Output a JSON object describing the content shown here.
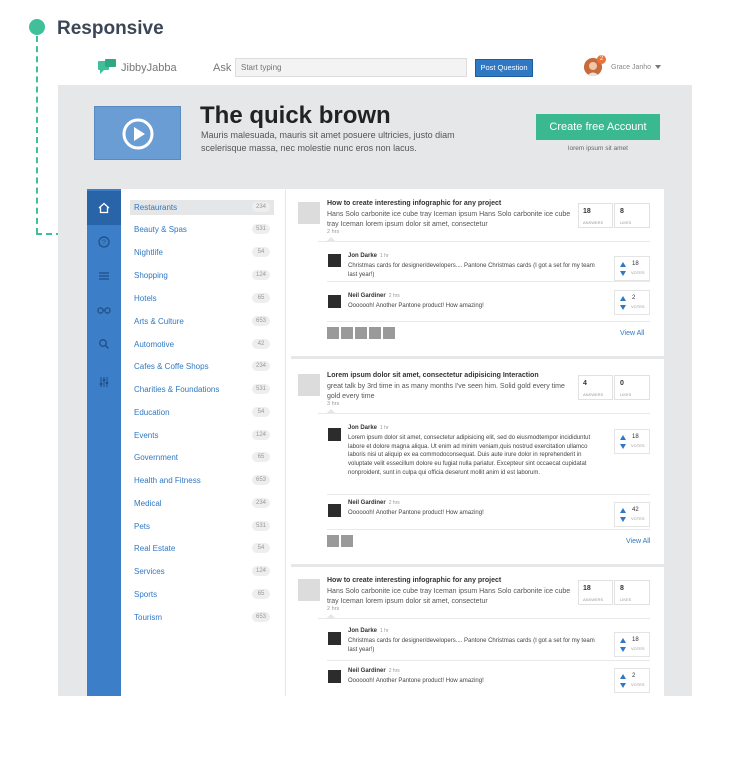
{
  "annotation": {
    "title": "Responsive"
  },
  "header": {
    "logo": "JibbyJabba",
    "ask_label": "Ask",
    "search_placeholder": "Start typing",
    "post_button": "Post Question",
    "user_name": "Grace Janho",
    "notification_count": "2"
  },
  "hero": {
    "title": "The quick brown",
    "description": "Mauris malesuada, mauris sit amet posuere ultricies, justo diam scelerisque massa, nec molestie nunc eros non lacus.",
    "cta": "Create free Account",
    "cta_sub": "lorem ipsum sit amet"
  },
  "nav_icons": [
    "home-icon",
    "question-icon",
    "menu-icon",
    "glasses-icon",
    "search-icon",
    "settings-sliders-icon"
  ],
  "categories": [
    {
      "label": "Restaurants",
      "count": "234"
    },
    {
      "label": "Beauty & Spas",
      "count": "531"
    },
    {
      "label": "Nightlife",
      "count": "54"
    },
    {
      "label": "Shopping",
      "count": "124"
    },
    {
      "label": "Hotels",
      "count": "65"
    },
    {
      "label": "Arts & Culture",
      "count": "653"
    },
    {
      "label": "Automotive",
      "count": "42"
    },
    {
      "label": "Cafes & Coffe Shops",
      "count": "234"
    },
    {
      "label": "Charities & Foundations",
      "count": "531"
    },
    {
      "label": "Education",
      "count": "54"
    },
    {
      "label": "Events",
      "count": "124"
    },
    {
      "label": "Government",
      "count": "65"
    },
    {
      "label": "Health and Fitness",
      "count": "653"
    },
    {
      "label": "Medical",
      "count": "234"
    },
    {
      "label": "Pets",
      "count": "531"
    },
    {
      "label": "Real Estate",
      "count": "54"
    },
    {
      "label": "Services",
      "count": "124"
    },
    {
      "label": "Sports",
      "count": "65"
    },
    {
      "label": "Tourism",
      "count": "653"
    }
  ],
  "questions": [
    {
      "title": "How to create interesting infographic for any project",
      "text": "Hans Solo carbonite ice cube tray Iceman ipsum Hans Solo carbonite ice cube tray Iceman lorem ipsum dolor sit amet, consectetur",
      "time": "2 hrs",
      "answers": "18",
      "answers_label": "ANSWERS",
      "likes": "8",
      "likes_label": "LIKES",
      "replies": [
        {
          "name": "Jon Darke",
          "time": "1 hr",
          "text": "Christmas cards for designer/developers.... Pantone Christmas cards (I got a set for my team last year!)",
          "votes": "18",
          "votes_label": "VOTES"
        },
        {
          "name": "Neil Gardiner",
          "time": "2 hrs",
          "text": "Ooooooh! Another Pantone product! How amazing!",
          "votes": "2",
          "votes_label": "VOTES"
        }
      ],
      "view_all": "View All"
    },
    {
      "title": "Lorem ipsum dolor sit amet, consectetur adipisicing Interaction",
      "text": "great talk by 3rd time in as many months I've seen him. Solid gold every time gold every time",
      "time": "3 hrs",
      "answers": "4",
      "answers_label": "ANSWERS",
      "likes": "0",
      "likes_label": "LIKES",
      "replies": [
        {
          "name": "Jon Darke",
          "time": "1 hr",
          "text": "Lorem ipsum dolor sit amet, consectetur adipisicing elit, sed do eiusmodtempor incididuntut labore et dolore magna aliqua. Ut enim ad minim veniam,quis nostrud exercitation ullamco laboris nisi ut aliquip ex ea commodoconsequat. Duis aute irure dolor in reprehenderit in voluptate velit essecillum dolore eu fugiat nulla pariatur. Excepteur sint occaecat cupidatat nonproident, sunt in culpa qui officia deserunt mollit anim id est laborum.",
          "votes": "18",
          "votes_label": "VOTES"
        },
        {
          "name": "Neil Gardiner",
          "time": "2 hrs",
          "text": "Ooooooh! Another Pantone product! How amazing!",
          "votes": "42",
          "votes_label": "VOTES"
        }
      ],
      "view_all": "View All"
    },
    {
      "title": "How to create interesting infographic for any project",
      "text": "Hans Solo carbonite ice cube tray Iceman ipsum Hans Solo carbonite ice cube tray Iceman lorem ipsum dolor sit amet, consectetur",
      "time": "2 hrs",
      "answers": "18",
      "answers_label": "ANSWERS",
      "likes": "8",
      "likes_label": "LIKES",
      "replies": [
        {
          "name": "Jon Darke",
          "time": "1 hr",
          "text": "Christmas cards for designer/developers.... Pantone Christmas cards (I got a set for my team last year!)",
          "votes": "18",
          "votes_label": "VOTES"
        },
        {
          "name": "Neil Gardiner",
          "time": "2 hrs",
          "text": "Ooooooh! Another Pantone product! How amazing!",
          "votes": "2",
          "votes_label": "VOTES"
        }
      ]
    }
  ],
  "colors": {
    "accent": "#3fbf9a",
    "primary": "#2f78c4",
    "sidebar": "#3c7ec8",
    "cta": "#3ab88f"
  }
}
